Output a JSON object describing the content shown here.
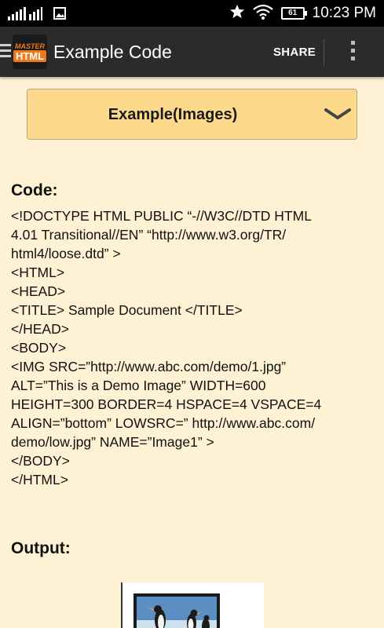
{
  "status_bar": {
    "time": "10:23 PM",
    "battery": "61",
    "icons": [
      "signal-icon",
      "image-icon",
      "star-icon",
      "wifi-icon",
      "battery-icon"
    ]
  },
  "app_bar": {
    "logo_top": "MASTER",
    "logo_bottom": "HTML",
    "title": "Example Code",
    "share_label": "SHARE",
    "icons": [
      "menu-icon",
      "overflow-menu-icon"
    ]
  },
  "dropdown": {
    "selected": "Example(Images)",
    "icon": "chevron-down-icon"
  },
  "code_section": {
    "heading": "Code:",
    "lines": [
      "<!DOCTYPE HTML PUBLIC “-//W3C//DTD HTML",
      "4.01 Transitional//EN” “http://www.w3.org/TR/",
      "html4/loose.dtd” >",
      "<HTML>",
      "<HEAD>",
      "<TITLE> Sample Document </TITLE>",
      "</HEAD>",
      "<BODY>",
      "<IMG SRC=”http://www.abc.com/demo/1.jpg”",
      "ALT=”This is a Demo Image” WIDTH=600",
      "HEIGHT=300 BORDER=4 HSPACE=4 VSPACE=4",
      "ALIGN=”bottom” LOWSRC=” http://www.abc.com/",
      "demo/low.jpg” NAME=”Image1” >",
      "</BODY>",
      "</HTML>"
    ]
  },
  "output_section": {
    "heading": "Output:"
  },
  "colors": {
    "background": "#fef1d4",
    "app_bar": "#2b2b2b",
    "dropdown": "#fdd98c",
    "logo_accent": "#f07a1a"
  }
}
